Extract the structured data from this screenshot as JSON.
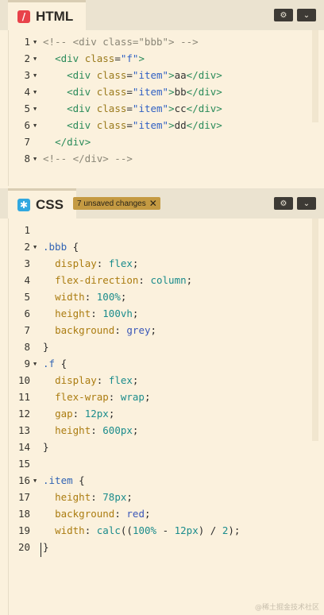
{
  "html_panel": {
    "title": "HTML",
    "icon_glyph": "/",
    "icon_color": "#e8424a",
    "settings_glyph": "⚙",
    "collapse_glyph": "⌄"
  },
  "css_panel": {
    "title": "CSS",
    "icon_glyph": "✱",
    "icon_color": "#31a8e0",
    "unsaved_badge": "7 unsaved changes",
    "badge_close_glyph": "✕",
    "settings_glyph": "⚙",
    "collapse_glyph": "⌄"
  },
  "html_code": [
    {
      "num": "1",
      "fold": true,
      "parts": [
        {
          "c": "cm",
          "t": "<!-- <div class=\"bbb\"> -->"
        }
      ]
    },
    {
      "num": "2",
      "fold": true,
      "parts": [
        {
          "c": "tx",
          "t": "  "
        },
        {
          "c": "tg",
          "t": "<div"
        },
        {
          "c": "tx",
          "t": " "
        },
        {
          "c": "at",
          "t": "class"
        },
        {
          "c": "tx",
          "t": "="
        },
        {
          "c": "st",
          "t": "\"f\""
        },
        {
          "c": "tg",
          "t": ">"
        }
      ]
    },
    {
      "num": "3",
      "fold": true,
      "parts": [
        {
          "c": "tx",
          "t": "    "
        },
        {
          "c": "tg",
          "t": "<div"
        },
        {
          "c": "tx",
          "t": " "
        },
        {
          "c": "at",
          "t": "class"
        },
        {
          "c": "tx",
          "t": "="
        },
        {
          "c": "st",
          "t": "\"item\""
        },
        {
          "c": "tg",
          "t": ">"
        },
        {
          "c": "tx",
          "t": "aa"
        },
        {
          "c": "tg",
          "t": "</div>"
        }
      ]
    },
    {
      "num": "4",
      "fold": true,
      "parts": [
        {
          "c": "tx",
          "t": "    "
        },
        {
          "c": "tg",
          "t": "<div"
        },
        {
          "c": "tx",
          "t": " "
        },
        {
          "c": "at",
          "t": "class"
        },
        {
          "c": "tx",
          "t": "="
        },
        {
          "c": "st",
          "t": "\"item\""
        },
        {
          "c": "tg",
          "t": ">"
        },
        {
          "c": "tx",
          "t": "bb"
        },
        {
          "c": "tg",
          "t": "</div>"
        }
      ]
    },
    {
      "num": "5",
      "fold": true,
      "parts": [
        {
          "c": "tx",
          "t": "    "
        },
        {
          "c": "tg",
          "t": "<div"
        },
        {
          "c": "tx",
          "t": " "
        },
        {
          "c": "at",
          "t": "class"
        },
        {
          "c": "tx",
          "t": "="
        },
        {
          "c": "st",
          "t": "\"item\""
        },
        {
          "c": "tg",
          "t": ">"
        },
        {
          "c": "tx",
          "t": "cc"
        },
        {
          "c": "tg",
          "t": "</div>"
        }
      ]
    },
    {
      "num": "6",
      "fold": true,
      "parts": [
        {
          "c": "tx",
          "t": "    "
        },
        {
          "c": "tg",
          "t": "<div"
        },
        {
          "c": "tx",
          "t": " "
        },
        {
          "c": "at",
          "t": "class"
        },
        {
          "c": "tx",
          "t": "="
        },
        {
          "c": "st",
          "t": "\"item\""
        },
        {
          "c": "tg",
          "t": ">"
        },
        {
          "c": "tx",
          "t": "dd"
        },
        {
          "c": "tg",
          "t": "</div>"
        }
      ]
    },
    {
      "num": "7",
      "fold": false,
      "parts": [
        {
          "c": "tx",
          "t": "  "
        },
        {
          "c": "tg",
          "t": "</div>"
        }
      ]
    },
    {
      "num": "8",
      "fold": true,
      "parts": [
        {
          "c": "cm",
          "t": "<!-- </div> -->"
        }
      ]
    }
  ],
  "css_code": [
    {
      "num": "1",
      "fold": false,
      "parts": []
    },
    {
      "num": "2",
      "fold": true,
      "parts": [
        {
          "c": "sel",
          "t": ".bbb"
        },
        {
          "c": "pn",
          "t": " {"
        }
      ]
    },
    {
      "num": "3",
      "fold": false,
      "parts": [
        {
          "c": "tx",
          "t": "  "
        },
        {
          "c": "pr",
          "t": "display"
        },
        {
          "c": "pn",
          "t": ": "
        },
        {
          "c": "vl",
          "t": "flex"
        },
        {
          "c": "pn",
          "t": ";"
        }
      ]
    },
    {
      "num": "4",
      "fold": false,
      "parts": [
        {
          "c": "tx",
          "t": "  "
        },
        {
          "c": "pr",
          "t": "flex-direction"
        },
        {
          "c": "pn",
          "t": ": "
        },
        {
          "c": "vl",
          "t": "column"
        },
        {
          "c": "pn",
          "t": ";"
        }
      ]
    },
    {
      "num": "5",
      "fold": false,
      "parts": [
        {
          "c": "tx",
          "t": "  "
        },
        {
          "c": "pr",
          "t": "width"
        },
        {
          "c": "pn",
          "t": ": "
        },
        {
          "c": "vl",
          "t": "100%"
        },
        {
          "c": "pn",
          "t": ";"
        }
      ]
    },
    {
      "num": "6",
      "fold": false,
      "parts": [
        {
          "c": "tx",
          "t": "  "
        },
        {
          "c": "pr",
          "t": "height"
        },
        {
          "c": "pn",
          "t": ": "
        },
        {
          "c": "vl",
          "t": "100vh"
        },
        {
          "c": "pn",
          "t": ";"
        }
      ]
    },
    {
      "num": "7",
      "fold": false,
      "parts": [
        {
          "c": "tx",
          "t": "  "
        },
        {
          "c": "pr",
          "t": "background"
        },
        {
          "c": "pn",
          "t": ": "
        },
        {
          "c": "kw",
          "t": "grey"
        },
        {
          "c": "pn",
          "t": ";"
        }
      ]
    },
    {
      "num": "8",
      "fold": false,
      "parts": [
        {
          "c": "pn",
          "t": "}"
        }
      ]
    },
    {
      "num": "9",
      "fold": true,
      "parts": [
        {
          "c": "sel",
          "t": ".f"
        },
        {
          "c": "pn",
          "t": " {"
        }
      ]
    },
    {
      "num": "10",
      "fold": false,
      "parts": [
        {
          "c": "tx",
          "t": "  "
        },
        {
          "c": "pr",
          "t": "display"
        },
        {
          "c": "pn",
          "t": ": "
        },
        {
          "c": "vl",
          "t": "flex"
        },
        {
          "c": "pn",
          "t": ";"
        }
      ]
    },
    {
      "num": "11",
      "fold": false,
      "parts": [
        {
          "c": "tx",
          "t": "  "
        },
        {
          "c": "pr",
          "t": "flex-wrap"
        },
        {
          "c": "pn",
          "t": ": "
        },
        {
          "c": "vl",
          "t": "wrap"
        },
        {
          "c": "pn",
          "t": ";"
        }
      ]
    },
    {
      "num": "12",
      "fold": false,
      "parts": [
        {
          "c": "tx",
          "t": "  "
        },
        {
          "c": "pr",
          "t": "gap"
        },
        {
          "c": "pn",
          "t": ": "
        },
        {
          "c": "vl",
          "t": "12px"
        },
        {
          "c": "pn",
          "t": ";"
        }
      ]
    },
    {
      "num": "13",
      "fold": false,
      "parts": [
        {
          "c": "tx",
          "t": "  "
        },
        {
          "c": "pr",
          "t": "height"
        },
        {
          "c": "pn",
          "t": ": "
        },
        {
          "c": "vl",
          "t": "600px"
        },
        {
          "c": "pn",
          "t": ";"
        }
      ]
    },
    {
      "num": "14",
      "fold": false,
      "parts": [
        {
          "c": "pn",
          "t": "}"
        }
      ]
    },
    {
      "num": "15",
      "fold": false,
      "parts": []
    },
    {
      "num": "16",
      "fold": true,
      "parts": [
        {
          "c": "sel",
          "t": ".item"
        },
        {
          "c": "pn",
          "t": " {"
        }
      ]
    },
    {
      "num": "17",
      "fold": false,
      "parts": [
        {
          "c": "tx",
          "t": "  "
        },
        {
          "c": "pr",
          "t": "height"
        },
        {
          "c": "pn",
          "t": ": "
        },
        {
          "c": "vl",
          "t": "78px"
        },
        {
          "c": "pn",
          "t": ";"
        }
      ]
    },
    {
      "num": "18",
      "fold": false,
      "parts": [
        {
          "c": "tx",
          "t": "  "
        },
        {
          "c": "pr",
          "t": "background"
        },
        {
          "c": "pn",
          "t": ": "
        },
        {
          "c": "kw",
          "t": "red"
        },
        {
          "c": "pn",
          "t": ";"
        }
      ]
    },
    {
      "num": "19",
      "fold": false,
      "parts": [
        {
          "c": "tx",
          "t": "  "
        },
        {
          "c": "pr",
          "t": "width"
        },
        {
          "c": "pn",
          "t": ": "
        },
        {
          "c": "vl",
          "t": "calc"
        },
        {
          "c": "pn",
          "t": "(("
        },
        {
          "c": "vl",
          "t": "100%"
        },
        {
          "c": "pn",
          "t": " - "
        },
        {
          "c": "vl",
          "t": "12px"
        },
        {
          "c": "pn",
          "t": ") / "
        },
        {
          "c": "vl",
          "t": "2"
        },
        {
          "c": "pn",
          "t": ");"
        }
      ]
    },
    {
      "num": "20",
      "fold": false,
      "parts": [
        {
          "c": "pn",
          "t": "}"
        }
      ]
    }
  ],
  "watermark": "@稀土掘金技术社区"
}
